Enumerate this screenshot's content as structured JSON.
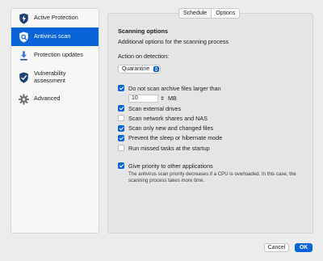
{
  "sidebar": {
    "items": [
      {
        "label": "Active Protection",
        "icon": "lightning-shield-icon"
      },
      {
        "label": "Antivirus scan",
        "icon": "scan-shield-icon"
      },
      {
        "label": "Protection updates",
        "icon": "download-arrow-icon"
      },
      {
        "label": "Vulnerability assessment",
        "icon": "vulnerability-shield-icon"
      },
      {
        "label": "Advanced",
        "icon": "gear-icon"
      }
    ],
    "active_index": 1
  },
  "tabs": [
    {
      "label": "Schedule",
      "selected": false
    },
    {
      "label": "Options",
      "selected": true
    }
  ],
  "main": {
    "title": "Scanning options",
    "subtitle": "Additional options for the scanning process",
    "action_label": "Action on detection:",
    "action_value": "Quarantine",
    "archive_limit": {
      "label": "Do not scan archive files larger than",
      "checked": true,
      "value": "10",
      "unit": "MB"
    },
    "options": [
      {
        "label": "Scan external drives",
        "checked": true
      },
      {
        "label": "Scan network shares and NAS",
        "checked": false
      },
      {
        "label": "Scan only new and changed files",
        "checked": true
      },
      {
        "label": "Prevent the sleep or hibernate mode",
        "checked": true
      },
      {
        "label": "Run missed tasks at the startup",
        "checked": false
      }
    ],
    "priority": {
      "label": "Give priority to other applications",
      "checked": true,
      "note": "The antivirus scan priority decreases if a CPU is overloaded. In this case, the scanning process takes more time."
    }
  },
  "footer": {
    "cancel_label": "Cancel",
    "ok_label": "OK"
  },
  "colors": {
    "accent": "#0a64d8",
    "window_bg": "#ececec",
    "panel_bg": "#e5e5e5"
  }
}
